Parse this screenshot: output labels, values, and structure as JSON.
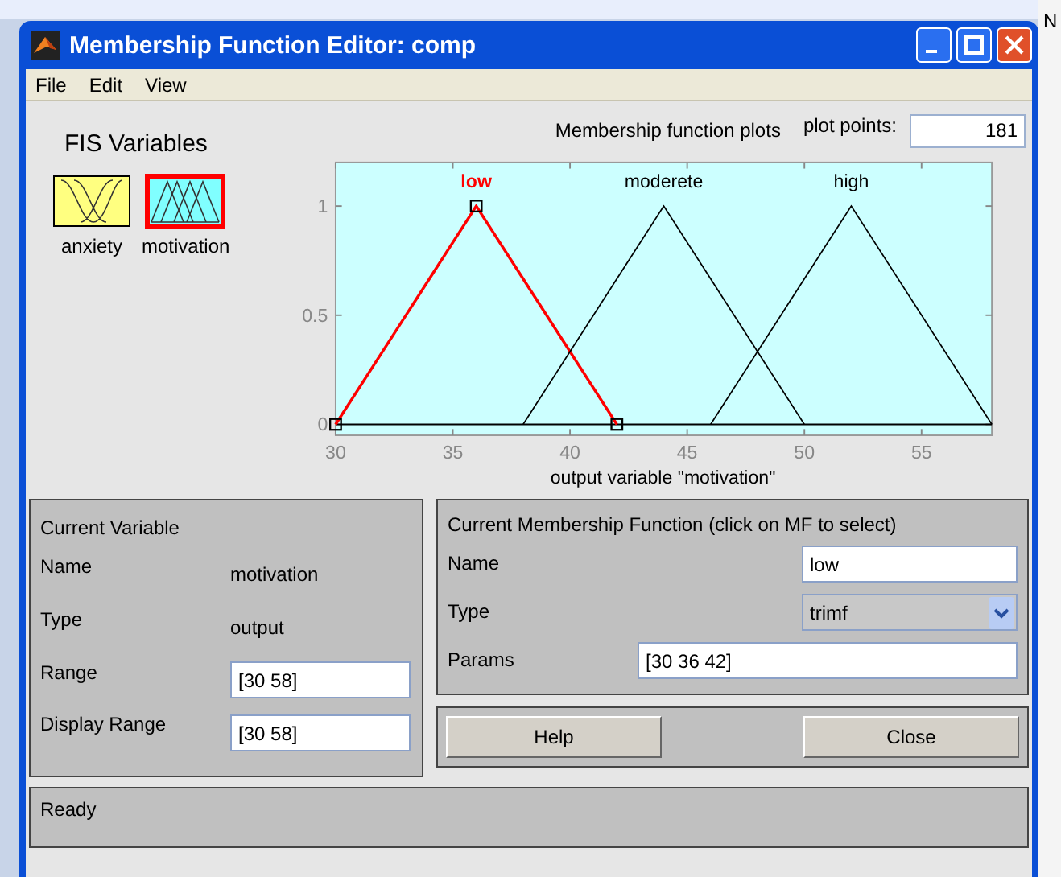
{
  "window": {
    "title": "Membership Function Editor: comp"
  },
  "menu": [
    "File",
    "Edit",
    "View"
  ],
  "fis_variables": {
    "heading": "FIS Variables",
    "items": [
      {
        "name": "anxiety",
        "kind": "input",
        "selected": false
      },
      {
        "name": "motivation",
        "kind": "output",
        "selected": true
      }
    ]
  },
  "plot": {
    "heading": "Membership function plots",
    "points_label": "plot points:",
    "points": "181",
    "curves": [
      {
        "selected": true
      },
      {
        "selected": false
      },
      {
        "selected": false
      }
    ],
    "chart_data": {
      "type": "line",
      "xlabel": "output variable \"motivation\"",
      "x": [
        30,
        36,
        38,
        42,
        44,
        46,
        50,
        52,
        58
      ],
      "xlim": [
        30,
        58
      ],
      "ylim": [
        -0.05,
        1.2
      ],
      "xticks": [
        30,
        35,
        40,
        45,
        50,
        55
      ],
      "yticks": [
        0,
        0.5,
        1
      ],
      "series": [
        {
          "name": "low",
          "color": "#ff0000",
          "values": [
            0,
            1,
            0.667,
            0,
            null,
            null,
            null,
            null,
            null
          ]
        },
        {
          "name": "moderete",
          "color": "#000000",
          "values": [
            null,
            null,
            0,
            0.667,
            1,
            0.667,
            0,
            null,
            null
          ]
        },
        {
          "name": "high",
          "color": "#000000",
          "values": [
            null,
            null,
            null,
            null,
            null,
            0,
            0.667,
            1,
            0
          ]
        }
      ]
    }
  },
  "current_variable": {
    "heading": "Current Variable",
    "rows": [
      {
        "kind": "text",
        "label": "Name",
        "value": "motivation"
      },
      {
        "kind": "text",
        "label": "Type",
        "value": "output"
      },
      {
        "kind": "field",
        "label": "Range",
        "value": "[30 58]"
      },
      {
        "kind": "field",
        "label": "Display Range",
        "value": "[30 58]"
      }
    ]
  },
  "current_mf": {
    "heading": "Current Membership Function (click on MF to select)",
    "name_label": "Name",
    "name": "low",
    "type_label": "Type",
    "type": "trimf",
    "params_label": "Params",
    "params": "[30 36 42]"
  },
  "buttons": [
    "Help",
    "Close"
  ],
  "status_bar": "Ready",
  "behind": {
    "text": "N"
  }
}
